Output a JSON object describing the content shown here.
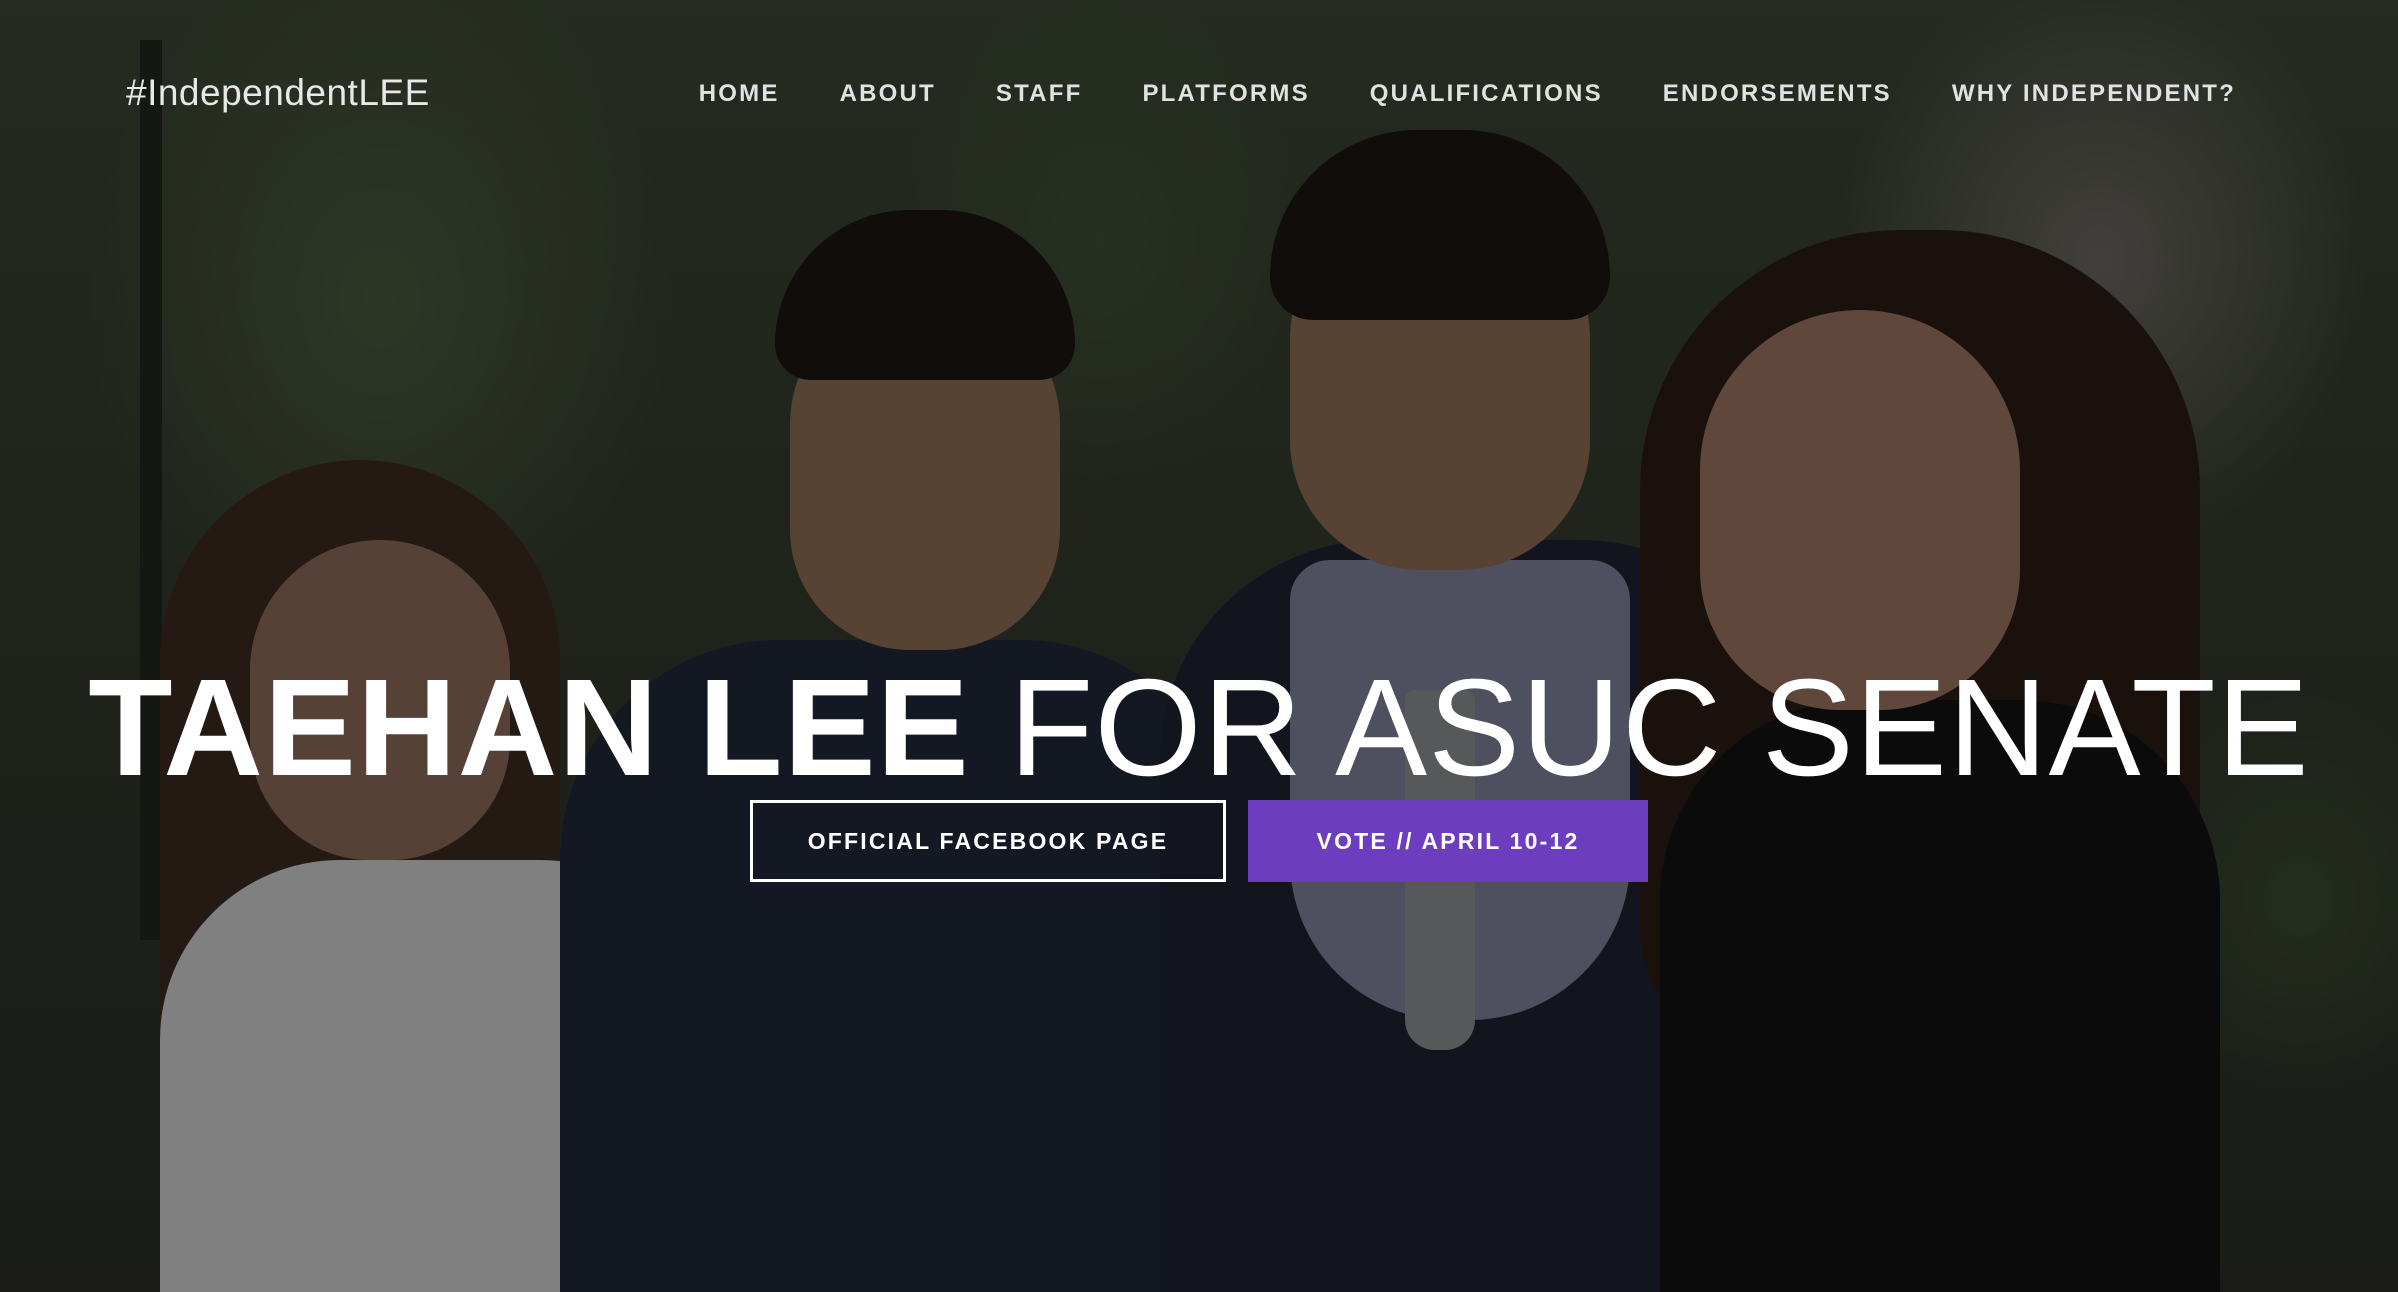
{
  "brand": {
    "title": "#IndependentLEE"
  },
  "nav": {
    "items": [
      {
        "label": "HOME"
      },
      {
        "label": "ABOUT"
      },
      {
        "label": "STAFF"
      },
      {
        "label": "PLATFORMS"
      },
      {
        "label": "QUALIFICATIONS"
      },
      {
        "label": "ENDORSEMENTS"
      },
      {
        "label": "WHY INDEPENDENT?"
      }
    ]
  },
  "hero": {
    "headline_bold": "TAEHAN LEE",
    "headline_light": "FOR ASUC SENATE",
    "buttons": {
      "facebook_label": "OFFICIAL FACEBOOK PAGE",
      "vote_label": "VOTE // APRIL 10-12"
    }
  },
  "colors": {
    "accent": "#6d3dc0",
    "text": "#ffffff"
  }
}
